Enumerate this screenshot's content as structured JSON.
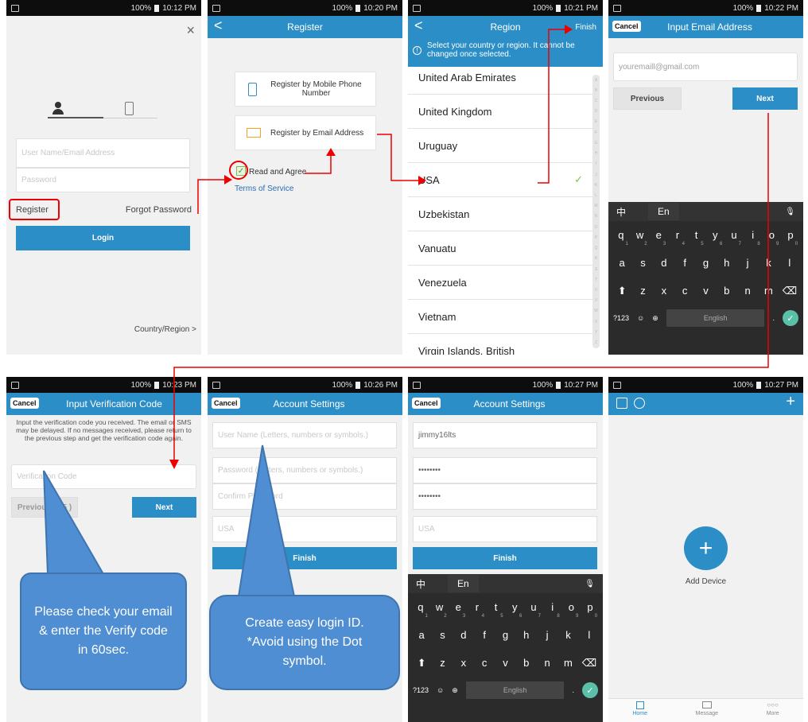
{
  "status": {
    "s1": "100%",
    "t1": "10:12 PM",
    "t2": "10:20 PM",
    "t3": "10:21 PM",
    "t4": "10:22 PM",
    "t5": "10:23 PM",
    "t6": "10:26 PM",
    "t7": "10:27 PM",
    "t8": "10:27 PM"
  },
  "login": {
    "user_placeholder": "User Name/Email Address",
    "pass_placeholder": "Password",
    "register": "Register",
    "forgot": "Forgot Password",
    "login": "Login",
    "country": "Country/Region >",
    "close": "×"
  },
  "reg": {
    "title": "Register",
    "back": "<",
    "phone": "Register by Mobile Phone Number",
    "email": "Register by Email Address",
    "agree": "Read and Agree",
    "terms": "Terms of Service"
  },
  "region": {
    "title": "Region",
    "finish": "Finish",
    "notice": "Select your country or region. It cannot be changed once selected.",
    "countries": [
      "United Arab Emirates",
      "United Kingdom",
      "Uruguay",
      "USA",
      "Uzbekistan",
      "Vanuatu",
      "Venezuela",
      "Vietnam",
      "Virgin Islands, British"
    ],
    "letters": [
      "A",
      "B",
      "C",
      "D",
      "E",
      "F",
      "G",
      "H",
      "I",
      "J",
      "K",
      "L",
      "M",
      "N",
      "O",
      "P",
      "Q",
      "R",
      "S",
      "T",
      "U",
      "V",
      "W",
      "X",
      "Y",
      "Z"
    ]
  },
  "email": {
    "title": "Input Email Address",
    "cancel": "Cancel",
    "value": "youremaill@gmail.com",
    "previous": "Previous",
    "next": "Next"
  },
  "kb": {
    "zh": "中",
    "en": "En",
    "mic": "🎙",
    "r1": [
      "q",
      "w",
      "e",
      "r",
      "t",
      "y",
      "u",
      "i",
      "o",
      "p"
    ],
    "n1": [
      "1",
      "2",
      "3",
      "4",
      "5",
      "6",
      "7",
      "8",
      "9",
      "0"
    ],
    "r2": [
      "a",
      "s",
      "d",
      "f",
      "g",
      "h",
      "j",
      "k",
      "l"
    ],
    "r3": [
      "z",
      "x",
      "c",
      "v",
      "b",
      "n",
      "m"
    ],
    "sym": "?123",
    "lang": "English",
    "shift": "⬆",
    "del": "⌫",
    "ok": "✓",
    "emoji": "☺",
    "globe": "⊕",
    "dot": "."
  },
  "verify": {
    "title": "Input Verification Code",
    "cancel": "Cancel",
    "info": "Input the verification code you received. The email or SMS may be delayed. If no messages received, please return to the previous step and get the verification code again.",
    "placeholder": "Verification Code",
    "previous": "Previous ( 55 )",
    "next": "Next"
  },
  "acct": {
    "title": "Account Settings",
    "cancel": "Cancel",
    "user": "User Name (Letters, numbers or symbols.)",
    "pass": "Password (Letters, numbers or symbols.)",
    "confirm": "Confirm Password",
    "country": "USA",
    "finish": "Finish",
    "filled_user": "jimmy16lts",
    "dots": "••••••••"
  },
  "home": {
    "add": "+",
    "add_label": "Add Device",
    "tab_home": "Home",
    "tab_msg": "Message",
    "tab_more": "More"
  },
  "callouts": {
    "c1": "Please check your email & enter the Verify code in 60sec.",
    "c2": "Create easy login ID. *Avoid using the Dot symbol."
  }
}
